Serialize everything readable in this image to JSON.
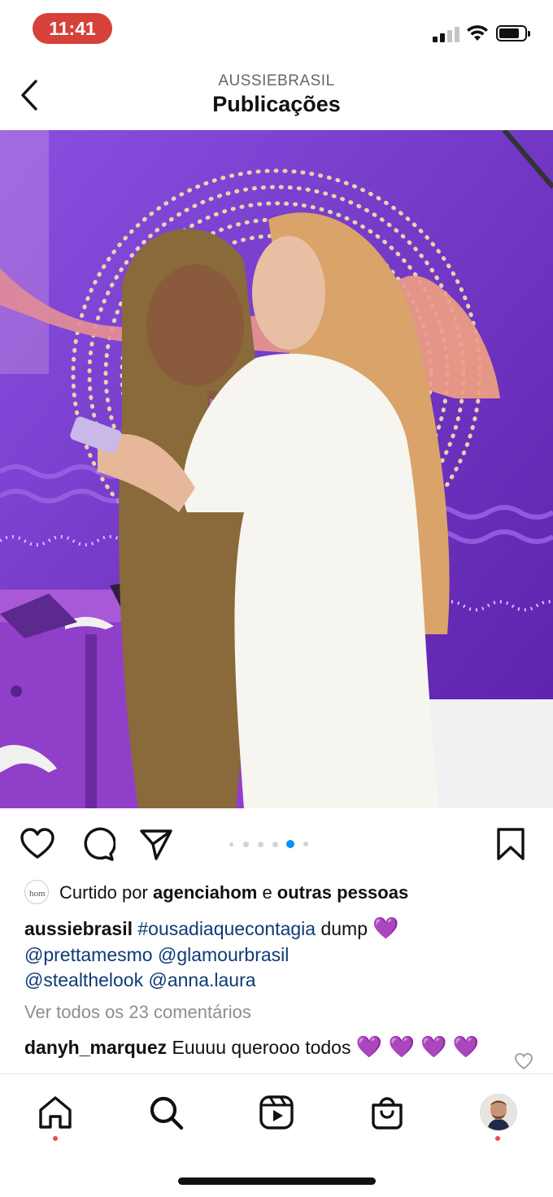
{
  "status": {
    "time": "11:41"
  },
  "header": {
    "subtitle": "AUSSIEBRASIL",
    "title": "Publicações"
  },
  "post": {
    "carousel": {
      "count": 6,
      "active_index": 4
    },
    "likes": {
      "prefix": "Curtido por ",
      "user": "agenciahom",
      "middle": " e ",
      "others": "outras pessoas"
    },
    "caption": {
      "author": "aussiebrasil",
      "hashtag": "#ousadiaqueconta gia",
      "hashtag_text": "#ousadiaquecontagia",
      "text": " dump ",
      "emoji": "💜",
      "mentions": [
        "@prettamesmo",
        "@glamourbrasil",
        "@stealthelook",
        "@anna.laura"
      ]
    },
    "view_comments": "Ver todos os 23 comentários",
    "comment": {
      "user": "danyh_marquez",
      "text": "Euuuu querooo todos",
      "emojis": "💜 💜 💜 💜"
    }
  },
  "colors": {
    "accent_blue": "#0095f6",
    "notif_red": "#ed4956",
    "tag_blue": "#0e3b75",
    "time_pill": "#d6413a"
  },
  "icons": {
    "back": "chevron-left-icon",
    "like": "heart-icon",
    "comment": "comment-icon",
    "share": "send-icon",
    "save": "bookmark-icon",
    "home": "home-icon",
    "search": "search-icon",
    "reels": "reels-icon",
    "shop": "shop-icon",
    "profile": "profile-avatar"
  }
}
